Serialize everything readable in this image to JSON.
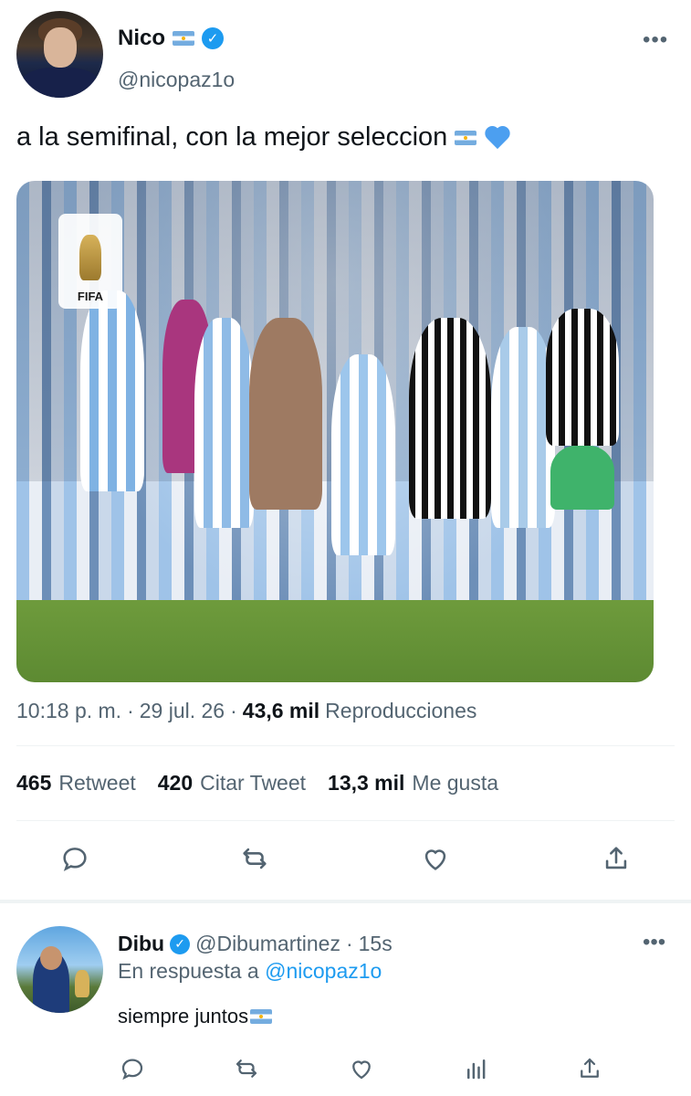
{
  "tweet": {
    "display_name": "Nico",
    "handle": "@nicopaz1o",
    "more_label": "•••",
    "text": "a la semifinal, con la mejor seleccion",
    "media": {
      "badge_text": "FIFA"
    },
    "time": "10:18 p. m.",
    "separator": "·",
    "date": "29 jul. 26",
    "views_count": "43,6 mil",
    "views_label": "Reproducciones",
    "stats": [
      {
        "count": "465",
        "label": "Retweet"
      },
      {
        "count": "420",
        "label": "Citar Tweet"
      },
      {
        "count": "13,3 mil",
        "label": "Me gusta"
      }
    ],
    "actions": [
      "reply-icon",
      "retweet-icon",
      "like-icon",
      "share-icon"
    ]
  },
  "reply": {
    "display_name": "Dibu",
    "handle": "@Dibumartinez",
    "separator": "·",
    "time": "15s",
    "more_label": "•••",
    "in_reply_prefix": "En respuesta a",
    "in_reply_mention": "@nicopaz1o",
    "text": "siempre juntos",
    "actions": [
      "reply-icon",
      "retweet-icon",
      "like-icon",
      "analytics-icon",
      "share-icon"
    ]
  },
  "colors": {
    "accent": "#1d9bf0",
    "secondary_text": "#536471",
    "primary_text": "#0f1419",
    "divider": "#eff3f4"
  }
}
